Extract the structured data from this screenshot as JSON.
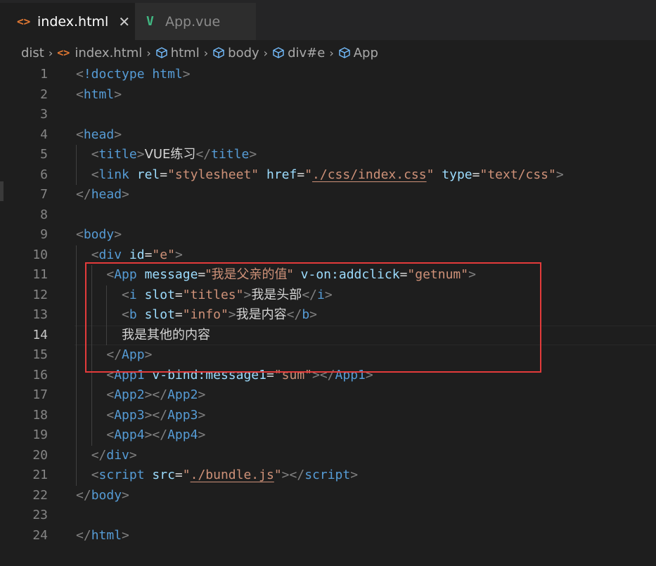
{
  "tabs": [
    {
      "label": "index.html",
      "icon": "html-file-icon",
      "active": true,
      "close": "✕"
    },
    {
      "label": "App.vue",
      "icon": "vue-file-icon",
      "active": false
    }
  ],
  "breadcrumb": [
    {
      "label": "dist",
      "icon": ""
    },
    {
      "label": "index.html",
      "icon": "html-file-icon"
    },
    {
      "label": "html",
      "icon": "element-cube-icon"
    },
    {
      "label": "body",
      "icon": "element-cube-icon"
    },
    {
      "label": "div#e",
      "icon": "element-cube-icon"
    },
    {
      "label": "App",
      "icon": "element-cube-icon"
    }
  ],
  "editor": {
    "current_line": 14,
    "lines": [
      {
        "n": "1",
        "tokens": [
          [
            "br",
            "<"
          ],
          [
            "tag",
            "!doctype"
          ],
          [
            "plain",
            " "
          ],
          [
            "tag",
            "html"
          ],
          [
            "br",
            ">"
          ]
        ]
      },
      {
        "n": "2",
        "tokens": [
          [
            "br",
            "<"
          ],
          [
            "tag",
            "html"
          ],
          [
            "br",
            ">"
          ]
        ]
      },
      {
        "n": "3",
        "tokens": []
      },
      {
        "n": "4",
        "tokens": [
          [
            "br",
            "<"
          ],
          [
            "tag",
            "head"
          ],
          [
            "br",
            ">"
          ]
        ]
      },
      {
        "n": "5",
        "tokens": [
          [
            "plain",
            "  "
          ],
          [
            "br",
            "<"
          ],
          [
            "tag",
            "title"
          ],
          [
            "br",
            ">"
          ],
          [
            "plain",
            "VUE练习"
          ],
          [
            "br",
            "</"
          ],
          [
            "tag",
            "title"
          ],
          [
            "br",
            ">"
          ]
        ]
      },
      {
        "n": "6",
        "tokens": [
          [
            "plain",
            "  "
          ],
          [
            "br",
            "<"
          ],
          [
            "tag",
            "link"
          ],
          [
            "plain",
            " "
          ],
          [
            "attr",
            "rel"
          ],
          [
            "eq",
            "="
          ],
          [
            "str",
            "\"stylesheet\""
          ],
          [
            "plain",
            " "
          ],
          [
            "attr",
            "href"
          ],
          [
            "eq",
            "="
          ],
          [
            "str",
            "\""
          ],
          [
            "link",
            "./css/index.css"
          ],
          [
            "str",
            "\""
          ],
          [
            "plain",
            " "
          ],
          [
            "attr",
            "type"
          ],
          [
            "eq",
            "="
          ],
          [
            "str",
            "\"text/css\""
          ],
          [
            "br",
            ">"
          ]
        ]
      },
      {
        "n": "7",
        "tokens": [
          [
            "br",
            "</"
          ],
          [
            "tag",
            "head"
          ],
          [
            "br",
            ">"
          ]
        ]
      },
      {
        "n": "8",
        "tokens": []
      },
      {
        "n": "9",
        "tokens": [
          [
            "br",
            "<"
          ],
          [
            "tag",
            "body"
          ],
          [
            "br",
            ">"
          ]
        ]
      },
      {
        "n": "10",
        "tokens": [
          [
            "plain",
            "  "
          ],
          [
            "br",
            "<"
          ],
          [
            "tag",
            "div"
          ],
          [
            "plain",
            " "
          ],
          [
            "attr",
            "id"
          ],
          [
            "eq",
            "="
          ],
          [
            "str",
            "\"e\""
          ],
          [
            "br",
            ">"
          ]
        ]
      },
      {
        "n": "11",
        "tokens": [
          [
            "plain",
            "    "
          ],
          [
            "br",
            "<"
          ],
          [
            "tag",
            "App"
          ],
          [
            "plain",
            " "
          ],
          [
            "attr",
            "message"
          ],
          [
            "eq",
            "="
          ],
          [
            "str",
            "\"我是父亲的值\""
          ],
          [
            "plain",
            " "
          ],
          [
            "attr",
            "v-on:addclick"
          ],
          [
            "eq",
            "="
          ],
          [
            "str",
            "\"getnum\""
          ],
          [
            "br",
            ">"
          ]
        ]
      },
      {
        "n": "12",
        "tokens": [
          [
            "plain",
            "      "
          ],
          [
            "br",
            "<"
          ],
          [
            "tag",
            "i"
          ],
          [
            "plain",
            " "
          ],
          [
            "attr",
            "slot"
          ],
          [
            "eq",
            "="
          ],
          [
            "str",
            "\"titles\""
          ],
          [
            "br",
            ">"
          ],
          [
            "plain",
            "我是头部"
          ],
          [
            "br",
            "</"
          ],
          [
            "tag",
            "i"
          ],
          [
            "br",
            ">"
          ]
        ]
      },
      {
        "n": "13",
        "tokens": [
          [
            "plain",
            "      "
          ],
          [
            "br",
            "<"
          ],
          [
            "tag",
            "b"
          ],
          [
            "plain",
            " "
          ],
          [
            "attr",
            "slot"
          ],
          [
            "eq",
            "="
          ],
          [
            "str",
            "\"info\""
          ],
          [
            "br",
            ">"
          ],
          [
            "plain",
            "我是内容"
          ],
          [
            "br",
            "</"
          ],
          [
            "tag",
            "b"
          ],
          [
            "br",
            ">"
          ]
        ]
      },
      {
        "n": "14",
        "tokens": [
          [
            "plain",
            "      "
          ],
          [
            "plain",
            "我是其他的内容"
          ]
        ]
      },
      {
        "n": "15",
        "tokens": [
          [
            "plain",
            "    "
          ],
          [
            "br",
            "</"
          ],
          [
            "tag",
            "App"
          ],
          [
            "br",
            ">"
          ]
        ]
      },
      {
        "n": "16",
        "tokens": [
          [
            "plain",
            "    "
          ],
          [
            "br",
            "<"
          ],
          [
            "tag",
            "App1"
          ],
          [
            "plain",
            " "
          ],
          [
            "attr",
            "v-bind:message1"
          ],
          [
            "eq",
            "="
          ],
          [
            "str",
            "\"sum\""
          ],
          [
            "br",
            "></"
          ],
          [
            "tag",
            "App1"
          ],
          [
            "br",
            ">"
          ]
        ]
      },
      {
        "n": "17",
        "tokens": [
          [
            "plain",
            "    "
          ],
          [
            "br",
            "<"
          ],
          [
            "tag",
            "App2"
          ],
          [
            "br",
            "></"
          ],
          [
            "tag",
            "App2"
          ],
          [
            "br",
            ">"
          ]
        ]
      },
      {
        "n": "18",
        "tokens": [
          [
            "plain",
            "    "
          ],
          [
            "br",
            "<"
          ],
          [
            "tag",
            "App3"
          ],
          [
            "br",
            "></"
          ],
          [
            "tag",
            "App3"
          ],
          [
            "br",
            ">"
          ]
        ]
      },
      {
        "n": "19",
        "tokens": [
          [
            "plain",
            "    "
          ],
          [
            "br",
            "<"
          ],
          [
            "tag",
            "App4"
          ],
          [
            "br",
            "></"
          ],
          [
            "tag",
            "App4"
          ],
          [
            "br",
            ">"
          ]
        ]
      },
      {
        "n": "20",
        "tokens": [
          [
            "plain",
            "  "
          ],
          [
            "br",
            "</"
          ],
          [
            "tag",
            "div"
          ],
          [
            "br",
            ">"
          ]
        ]
      },
      {
        "n": "21",
        "tokens": [
          [
            "plain",
            "  "
          ],
          [
            "br",
            "<"
          ],
          [
            "tag",
            "script"
          ],
          [
            "plain",
            " "
          ],
          [
            "attr",
            "src"
          ],
          [
            "eq",
            "="
          ],
          [
            "str",
            "\""
          ],
          [
            "link",
            "./bundle.js"
          ],
          [
            "str",
            "\""
          ],
          [
            "br",
            "></"
          ],
          [
            "tag",
            "script"
          ],
          [
            "br",
            ">"
          ]
        ]
      },
      {
        "n": "22",
        "tokens": [
          [
            "br",
            "</"
          ],
          [
            "tag",
            "body"
          ],
          [
            "br",
            ">"
          ]
        ]
      },
      {
        "n": "23",
        "tokens": []
      },
      {
        "n": "24",
        "tokens": [
          [
            "br",
            "</"
          ],
          [
            "tag",
            "html"
          ],
          [
            "br",
            ">"
          ]
        ]
      }
    ]
  },
  "colors": {
    "tag": "#569cd6",
    "attribute": "#9cdcfe",
    "string": "#ce9178",
    "highlight_box": "#e33b3b",
    "background": "#1e1e1e"
  }
}
